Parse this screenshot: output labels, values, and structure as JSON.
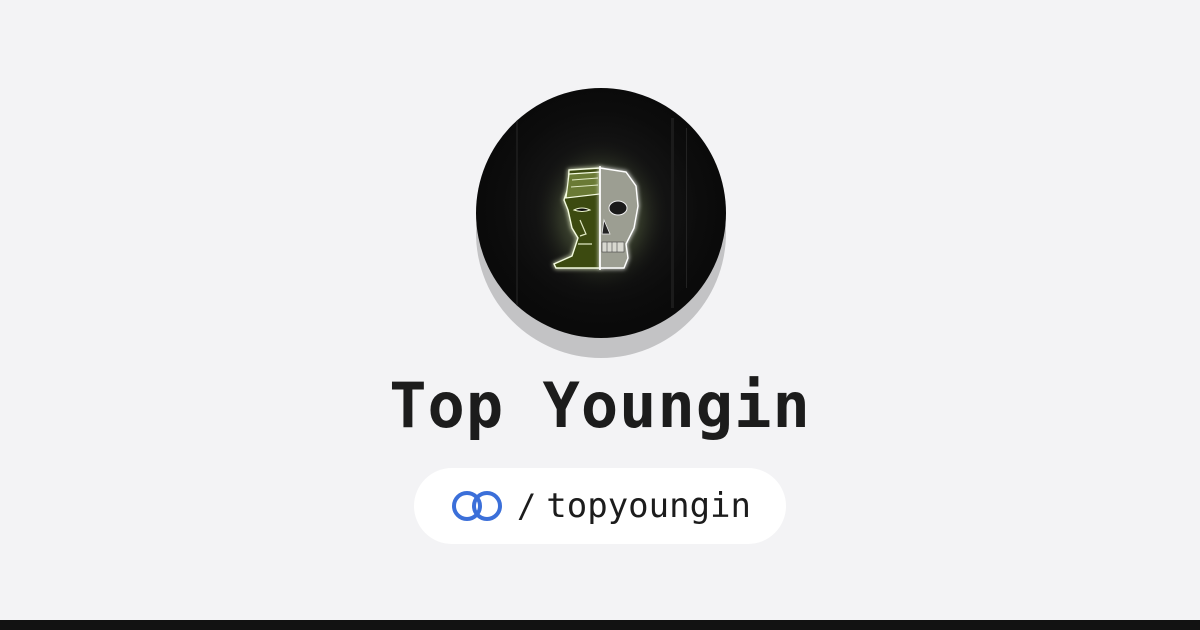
{
  "profile": {
    "display_name": "Top Youngin",
    "avatar_icon": "glowing-half-face-half-skull-portrait",
    "slash": "/",
    "handle": "topyoungin"
  },
  "icons": {
    "link": "chain-link-icon"
  },
  "colors": {
    "background": "#f3f3f5",
    "text": "#1c1c1c",
    "link_icon_accent": "#3b6fd9",
    "bottom_bar": "#121212"
  }
}
